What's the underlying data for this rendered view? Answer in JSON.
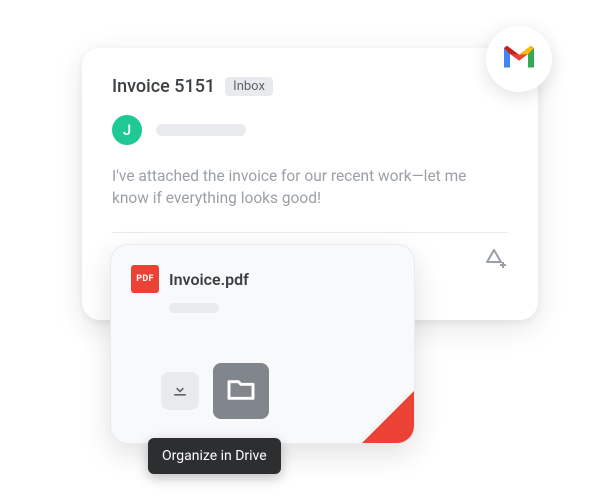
{
  "email": {
    "subject": "Invoice 5151",
    "inbox_label": "Inbox",
    "avatar_initial": "J",
    "body": "I've attached the invoice for our recent work—let me know if everything looks good!"
  },
  "attachment": {
    "pdf_badge": "PDF",
    "filename": "Invoice.pdf"
  },
  "tooltip": {
    "text": "Organize in Drive"
  }
}
